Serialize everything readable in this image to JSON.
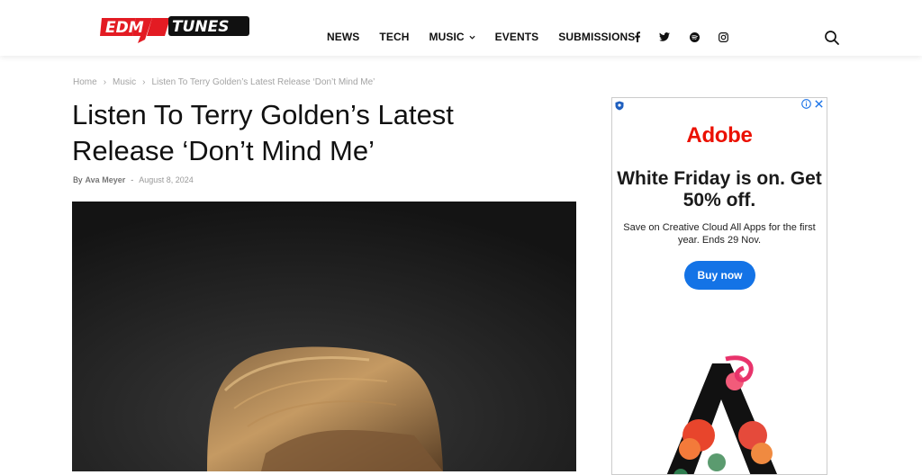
{
  "header": {
    "logo_text": "EDMTUNES",
    "nav": [
      {
        "label": "NEWS",
        "has_dropdown": false
      },
      {
        "label": "TECH",
        "has_dropdown": false
      },
      {
        "label": "MUSIC",
        "has_dropdown": true
      },
      {
        "label": "EVENTS",
        "has_dropdown": false
      },
      {
        "label": "SUBMISSIONS",
        "has_dropdown": false
      }
    ],
    "social": [
      "facebook-icon",
      "twitter-icon",
      "spotify-icon",
      "instagram-icon"
    ],
    "search_icon": "search-icon"
  },
  "breadcrumb": {
    "items": [
      "Home",
      "Music",
      "Listen To Terry Golden’s Latest Release ‘Don’t Mind Me’"
    ],
    "separator": "›"
  },
  "article": {
    "title": "Listen To Terry Golden’s Latest Release ‘Don’t Mind Me’",
    "by_label": "By",
    "author": "Ava Meyer",
    "dash": "-",
    "date": "August 8, 2024"
  },
  "ad": {
    "brand": "Adobe",
    "headline": "White Friday is on. Get 50% off.",
    "subtext": "Save on Creative Cloud All Apps for the first year. Ends 29 Nov.",
    "button_label": "Buy now",
    "brand_color": "#eb1000",
    "button_color": "#1473e6"
  }
}
